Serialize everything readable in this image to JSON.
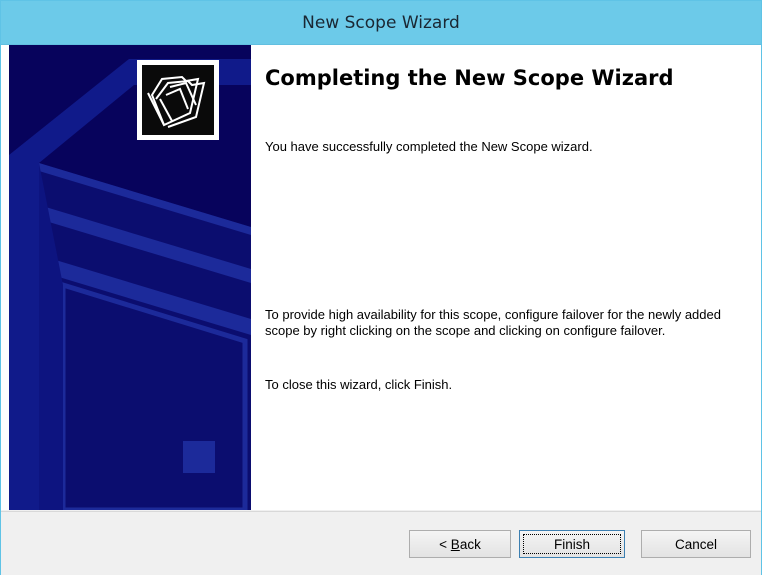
{
  "window": {
    "title": "New Scope Wizard"
  },
  "main": {
    "heading": "Completing the New Scope Wizard",
    "paragraph1": "You have successfully completed the New Scope wizard.",
    "paragraph2": "To provide high availability for this scope, configure failover for the newly added scope by right clicking on the scope and clicking on configure failover.",
    "paragraph3": "To close this wizard, click Finish."
  },
  "sidebar": {
    "icon": "folder-wizard-icon",
    "background_color": "#07035c",
    "accent_color": "#1c2a9a"
  },
  "buttons": {
    "back_prefix": "< ",
    "back_accel": "B",
    "back_rest": "ack",
    "finish": "Finish",
    "cancel": "Cancel"
  },
  "colors": {
    "titlebar": "#6ccae9",
    "window_border": "#5fc3e6",
    "footer": "#f0f0f0"
  }
}
